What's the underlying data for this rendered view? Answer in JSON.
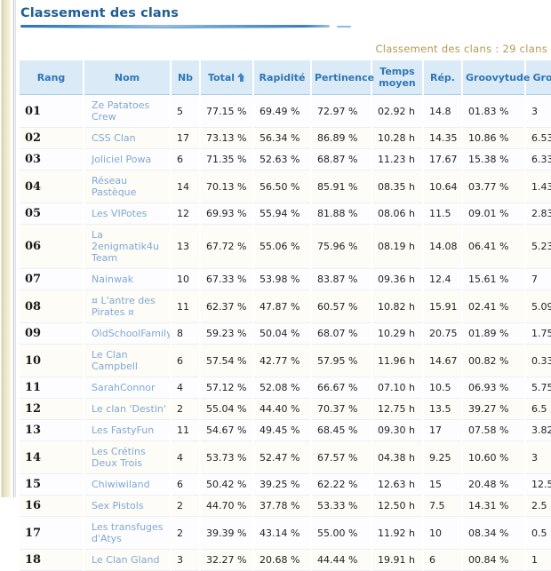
{
  "page": {
    "title": "Classement des clans",
    "summary": "Classement des clans : 29 clans",
    "accent_color": "#2f76b5",
    "summary_color": "#b49a4e",
    "link_color": "#7fa8d4",
    "header_bg": "#dbeaf7"
  },
  "table": {
    "sort_icon": "sort-ascending-arrow-icon",
    "sorted_column": "Total",
    "columns": [
      {
        "key": "rang",
        "label": "Rang"
      },
      {
        "key": "nom",
        "label": "Nom"
      },
      {
        "key": "nb",
        "label": "Nb"
      },
      {
        "key": "total",
        "label": "Total"
      },
      {
        "key": "rapidite",
        "label": "Rapidité"
      },
      {
        "key": "pertinence",
        "label": "Pertinence"
      },
      {
        "key": "temps",
        "label": "Temps moyen"
      },
      {
        "key": "rep",
        "label": "Rép."
      },
      {
        "key": "groovytude",
        "label": "Groovytude"
      },
      {
        "key": "groovy",
        "label": "Groovy"
      }
    ],
    "rows": [
      {
        "rang": "01",
        "nom": "Ze Patatoes Crew",
        "nb": "5",
        "total": "77.15 %",
        "rapidite": "69.49 %",
        "pertinence": "72.97 %",
        "temps": "02.92 h",
        "rep": "14.8",
        "groovytude": "01.83 %",
        "groovy": "3"
      },
      {
        "rang": "02",
        "nom": "CSS Clan",
        "nb": "17",
        "total": "73.13 %",
        "rapidite": "56.34 %",
        "pertinence": "86.89 %",
        "temps": "10.28 h",
        "rep": "14.35",
        "groovytude": "10.86 %",
        "groovy": "6.53"
      },
      {
        "rang": "03",
        "nom": "Joliciel Powa",
        "nb": "6",
        "total": "71.35 %",
        "rapidite": "52.63 %",
        "pertinence": "68.87 %",
        "temps": "11.23 h",
        "rep": "17.67",
        "groovytude": "15.38 %",
        "groovy": "6.33"
      },
      {
        "rang": "04",
        "nom": "Réseau Pastèque",
        "nb": "14",
        "total": "70.13 %",
        "rapidite": "56.50 %",
        "pertinence": "85.91 %",
        "temps": "08.35 h",
        "rep": "10.64",
        "groovytude": "03.77 %",
        "groovy": "1.43"
      },
      {
        "rang": "05",
        "nom": "Les VIPotes",
        "nb": "12",
        "total": "69.93 %",
        "rapidite": "55.94 %",
        "pertinence": "81.88 %",
        "temps": "08.06 h",
        "rep": "11.5",
        "groovytude": "09.01 %",
        "groovy": "2.83"
      },
      {
        "rang": "06",
        "nom": "La 2enigmatik4u Team",
        "nb": "13",
        "total": "67.72 %",
        "rapidite": "55.06 %",
        "pertinence": "75.96 %",
        "temps": "08.19 h",
        "rep": "14.08",
        "groovytude": "06.41 %",
        "groovy": "5.23"
      },
      {
        "rang": "07",
        "nom": "Nainwak",
        "nb": "10",
        "total": "67.33 %",
        "rapidite": "53.98 %",
        "pertinence": "83.87 %",
        "temps": "09.36 h",
        "rep": "12.4",
        "groovytude": "15.61 %",
        "groovy": "7"
      },
      {
        "rang": "08",
        "nom": "¤ L'antre des Pirates ¤",
        "nb": "11",
        "total": "62.37 %",
        "rapidite": "47.87 %",
        "pertinence": "60.57 %",
        "temps": "10.82 h",
        "rep": "15.91",
        "groovytude": "02.41 %",
        "groovy": "5.09"
      },
      {
        "rang": "09",
        "nom": "OldSchoolFamily",
        "nb": "8",
        "total": "59.23 %",
        "rapidite": "50.04 %",
        "pertinence": "68.07 %",
        "temps": "10.29 h",
        "rep": "20.75",
        "groovytude": "01.89 %",
        "groovy": "1.75"
      },
      {
        "rang": "10",
        "nom": "Le Clan Campbell",
        "nb": "6",
        "total": "57.54 %",
        "rapidite": "42.77 %",
        "pertinence": "57.95 %",
        "temps": "11.96 h",
        "rep": "14.67",
        "groovytude": "00.82 %",
        "groovy": "0.33"
      },
      {
        "rang": "11",
        "nom": "SarahConnor",
        "nb": "4",
        "total": "57.12 %",
        "rapidite": "52.08 %",
        "pertinence": "66.67 %",
        "temps": "07.10 h",
        "rep": "10.5",
        "groovytude": "06.93 %",
        "groovy": "5.75"
      },
      {
        "rang": "12",
        "nom": "Le clan 'Destin'",
        "nb": "2",
        "total": "55.04 %",
        "rapidite": "44.40 %",
        "pertinence": "70.37 %",
        "temps": "12.75 h",
        "rep": "13.5",
        "groovytude": "39.27 %",
        "groovy": "6.5"
      },
      {
        "rang": "13",
        "nom": "Les FastyFun",
        "nb": "11",
        "total": "54.67 %",
        "rapidite": "49.45 %",
        "pertinence": "68.45 %",
        "temps": "09.30 h",
        "rep": "17",
        "groovytude": "07.58 %",
        "groovy": "3.82"
      },
      {
        "rang": "14",
        "nom": "Les Crétins Deux Trois",
        "nb": "4",
        "total": "53.73 %",
        "rapidite": "52.47 %",
        "pertinence": "67.57 %",
        "temps": "04.38 h",
        "rep": "9.25",
        "groovytude": "10.60 %",
        "groovy": "3"
      },
      {
        "rang": "15",
        "nom": "Chiwiwiland",
        "nb": "6",
        "total": "50.42 %",
        "rapidite": "39.25 %",
        "pertinence": "62.22 %",
        "temps": "12.63 h",
        "rep": "15",
        "groovytude": "20.48 %",
        "groovy": "12.5"
      },
      {
        "rang": "16",
        "nom": "Sex Pistols",
        "nb": "2",
        "total": "44.70 %",
        "rapidite": "37.78 %",
        "pertinence": "53.33 %",
        "temps": "12.50 h",
        "rep": "7.5",
        "groovytude": "14.31 %",
        "groovy": "2.5"
      },
      {
        "rang": "17",
        "nom": "Les transfuges d'Atys",
        "nb": "2",
        "total": "39.39 %",
        "rapidite": "43.14 %",
        "pertinence": "55.00 %",
        "temps": "11.92 h",
        "rep": "10",
        "groovytude": "08.34 %",
        "groovy": "0.5"
      },
      {
        "rang": "18",
        "nom": "Le Clan Gland",
        "nb": "3",
        "total": "32.27 %",
        "rapidite": "20.68 %",
        "pertinence": "44.44 %",
        "temps": "19.91 h",
        "rep": "6",
        "groovytude": "00.84 %",
        "groovy": "1"
      }
    ]
  }
}
